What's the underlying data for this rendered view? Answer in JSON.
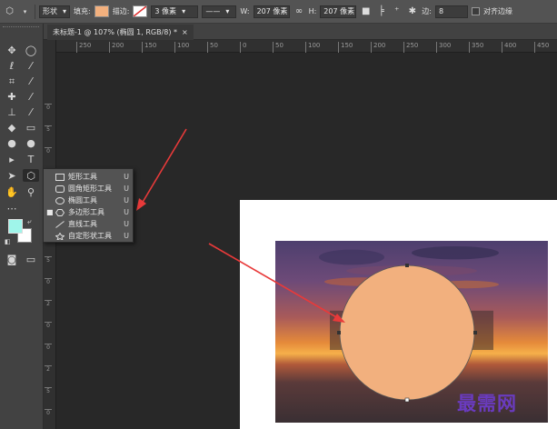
{
  "options_bar": {
    "mode_value": "形状",
    "fill_label": "填充:",
    "fill_color": "#f2b07e",
    "stroke_label": "描边:",
    "stroke_width": "3 像素",
    "width_label": "W:",
    "width_value": "207 像素",
    "height_label": "H:",
    "height_value": "207 像素",
    "sides_label": "边:",
    "sides_value": "8",
    "align_edges_label": "对齐边缘"
  },
  "tab": {
    "title": "未标题-1 @ 107% (椭圆 1, RGB/8) *",
    "close": "×"
  },
  "ruler": {
    "h_ticks": [
      "250",
      "200",
      "150",
      "100",
      "50",
      "0",
      "50",
      "100",
      "150",
      "200",
      "250",
      "300",
      "350",
      "400",
      "450",
      "500"
    ],
    "v_ticks": [
      "0",
      "5",
      "0",
      "1",
      "0",
      "0",
      "1",
      "5",
      "0",
      "2",
      "0",
      "0",
      "2",
      "5",
      "0"
    ]
  },
  "tools": {
    "move_icon": "move-icon",
    "key_hint": "U"
  },
  "flyout": {
    "items": [
      {
        "label": "矩形工具",
        "key": "U",
        "selected": false
      },
      {
        "label": "圆角矩形工具",
        "key": "U",
        "selected": false
      },
      {
        "label": "椭圆工具",
        "key": "U",
        "selected": false
      },
      {
        "label": "多边形工具",
        "key": "U",
        "selected": true
      },
      {
        "label": "直线工具",
        "key": "U",
        "selected": false
      },
      {
        "label": "自定形状工具",
        "key": "U",
        "selected": false
      }
    ]
  },
  "colors": {
    "foreground": "#9ff5ea",
    "background": "#ffffff",
    "circle_fill": "#f2b07e",
    "arrow": "#e83a3a",
    "watermark": "#6a3bbf"
  },
  "watermark": {
    "text": "最需网"
  }
}
